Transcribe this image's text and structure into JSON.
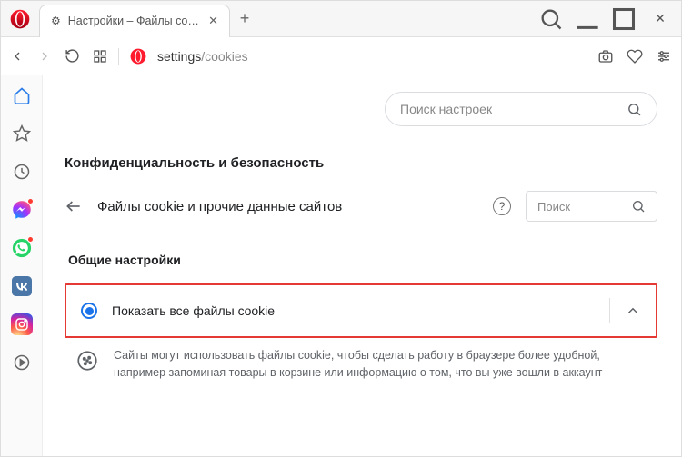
{
  "tab": {
    "title": "Настройки – Файлы cookie"
  },
  "address": {
    "prefix": "settings",
    "path": "/cookies"
  },
  "search": {
    "placeholder": "Поиск настроек"
  },
  "section": {
    "title": "Конфиденциальность и безопасность"
  },
  "sub": {
    "back": "←",
    "title": "Файлы cookie и прочие данные сайтов",
    "search_placeholder": "Поиск"
  },
  "group": {
    "title": "Общие настройки"
  },
  "option": {
    "label": "Показать все файлы cookie",
    "desc": "Сайты могут использовать файлы cookie, чтобы сделать работу в браузере более удобной, например запоминая товары в корзине или информацию о том, что вы уже вошли в аккаунт"
  },
  "icons": {
    "home": "home-icon",
    "bookmarks": "bookmark-icon"
  }
}
